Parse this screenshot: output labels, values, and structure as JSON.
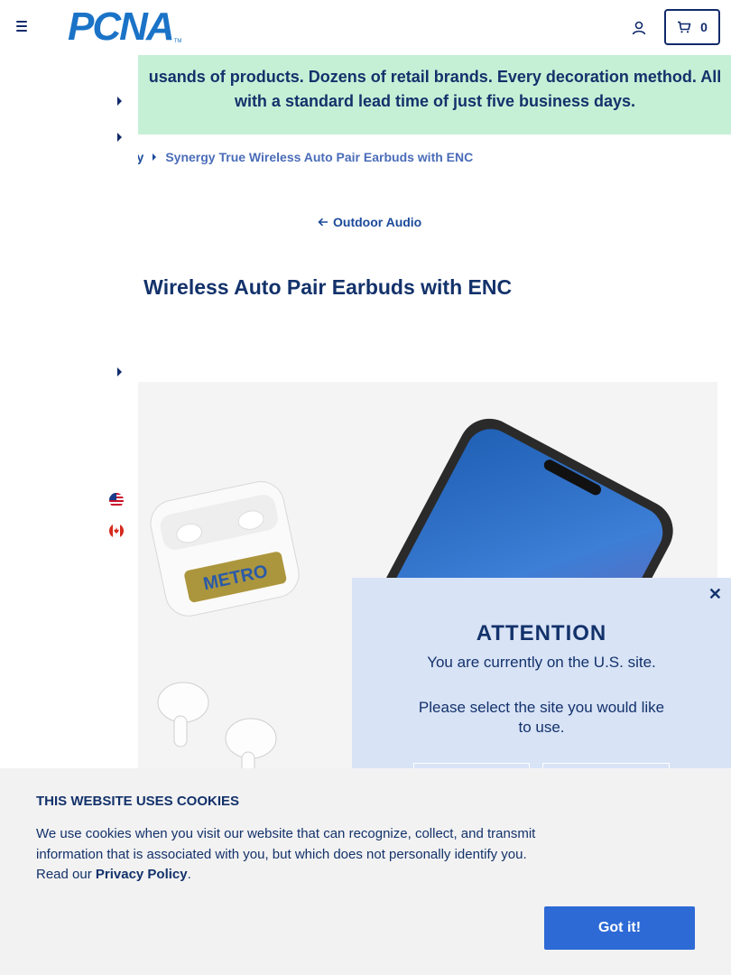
{
  "header": {
    "logo_text": "PCNA",
    "logo_tm": "TM",
    "cart_count": "0",
    "colors": {
      "brand": "#1a73c7",
      "navy": "#102a6b"
    }
  },
  "banner": {
    "text": "usands of products. Dozens of retail brands. Every decoration method. All\nwith a standard lead time of just five business days.",
    "background": "#c6f0d6"
  },
  "breadcrumb": {
    "items": [
      {
        "label": "gy"
      },
      {
        "label": "Synergy True Wireless Auto Pair Earbuds with ENC"
      }
    ]
  },
  "back_link": {
    "label": "Outdoor Audio"
  },
  "product": {
    "title": "e Wireless Auto Pair Earbuds with ENC",
    "image_decoration_text": "METRO"
  },
  "site_modal": {
    "title": "ATTENTION",
    "line1": "You are currently on the U.S. site.",
    "line2": "Please select the site you would like to use.",
    "background": "#d8e3f6"
  },
  "cookie_banner": {
    "title": "THIS WEBSITE USES COOKIES",
    "body": "We use cookies when you visit our website that can recognize, collect, and transmit information that is associated with you, but which does not personally identify you. Read our ",
    "link_label": "Privacy Policy",
    "tail": ".",
    "button_label": "Got it!",
    "button_color": "#2d6ad6"
  }
}
